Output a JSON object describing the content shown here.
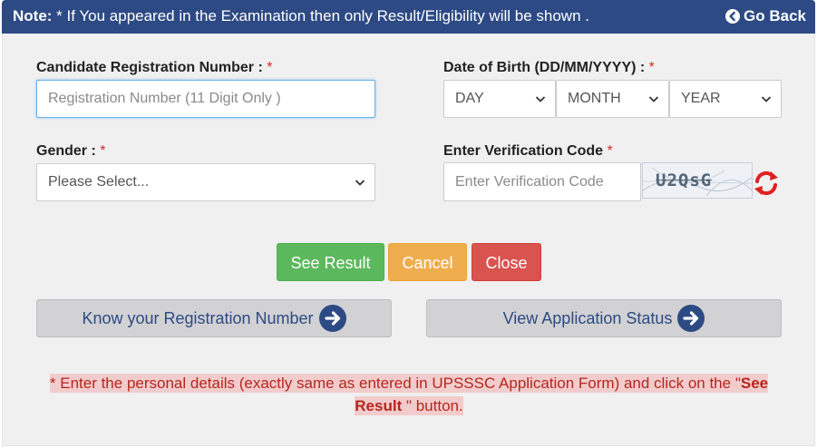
{
  "header": {
    "note_label": "Note:",
    "note_text": " * If You appeared in the Examination then only Result/Eligibility will be shown .",
    "back_label": "Go Back"
  },
  "form": {
    "reg_label": "Candidate Registration Number :",
    "reg_placeholder": "Registration Number (11 Digit Only )",
    "dob_label": "Date of Birth (DD/MM/YYYY) :",
    "dob_day": "DAY",
    "dob_month": "MONTH",
    "dob_year": "YEAR",
    "gender_label": "Gender :",
    "gender_value": "Please Select...",
    "verify_label": "Enter Verification Code",
    "verify_placeholder": "Enter Verification Code",
    "captcha_text": "U2QsG",
    "required_mark": "*"
  },
  "buttons": {
    "see_result": "See Result",
    "cancel": "Cancel",
    "close": "Close",
    "know_reg": "Know your Registration Number",
    "view_status": "View Application Status"
  },
  "notice": {
    "part1": "* Enter the personal details (exactly same as entered in UPSSSC Application Form) and click on the \"",
    "bold": "See Result",
    "part2": " \" button."
  },
  "colors": {
    "header_bg": "#2d4a84",
    "green": "#5cb85c",
    "orange": "#f0ad4e",
    "red": "#d9534f",
    "notice_text": "#b5261e"
  },
  "icons": [
    "arrow-circle-left-icon",
    "chevron-down-icon",
    "refresh-icon",
    "arrow-circle-right-icon"
  ]
}
